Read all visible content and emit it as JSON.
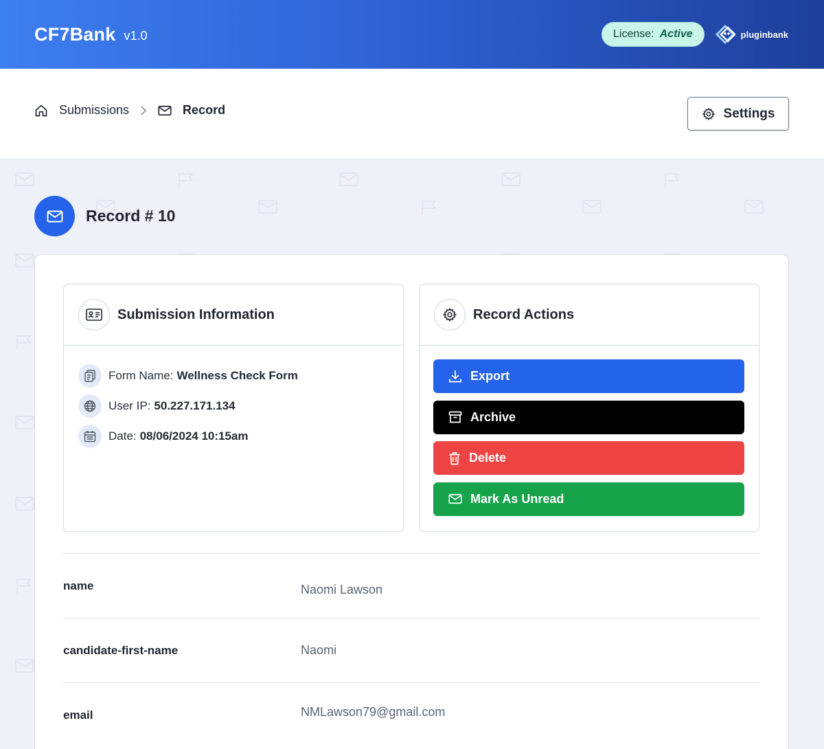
{
  "header": {
    "brand": "CF7Bank",
    "version": "v1.0",
    "license_label": "License:",
    "license_status": "Active",
    "partner_logo_text": "pluginbank",
    "colors": {
      "gradient_start": "#3d7ef0",
      "gradient_end": "#1e3f9b",
      "license_bg": "#c9f5e9"
    }
  },
  "breadcrumb": {
    "items": [
      {
        "label": "Submissions",
        "icon": "home-icon"
      },
      {
        "label": "Record",
        "icon": "envelope-icon"
      }
    ]
  },
  "toolbar": {
    "settings_label": "Settings"
  },
  "record": {
    "title": "Record # 10",
    "icon": "envelope-icon"
  },
  "submission_info": {
    "title": "Submission Information",
    "icon": "id-card-icon",
    "rows": [
      {
        "label": "Form Name:",
        "value": "Wellness Check Form",
        "icon": "clipboard-icon"
      },
      {
        "label": "User IP:",
        "value": "50.227.171.134",
        "icon": "globe-icon"
      },
      {
        "label": "Date:",
        "value": "08/06/2024 10:15am",
        "icon": "calendar-icon"
      }
    ]
  },
  "record_actions": {
    "title": "Record Actions",
    "icon": "gear-icon",
    "buttons": [
      {
        "label": "Export",
        "icon": "download-icon",
        "color": "#2563eb"
      },
      {
        "label": "Archive",
        "icon": "archive-icon",
        "color": "#000000"
      },
      {
        "label": "Delete",
        "icon": "trash-icon",
        "color": "#ef4444"
      },
      {
        "label": "Mark As Unread",
        "icon": "envelope-icon",
        "color": "#16a34a"
      }
    ]
  },
  "fields": [
    {
      "key": "name",
      "value": "Naomi Lawson"
    },
    {
      "key": "candidate-first-name",
      "value": "Naomi"
    },
    {
      "key": "email",
      "value": "NMLawson79@gmail.com"
    }
  ]
}
